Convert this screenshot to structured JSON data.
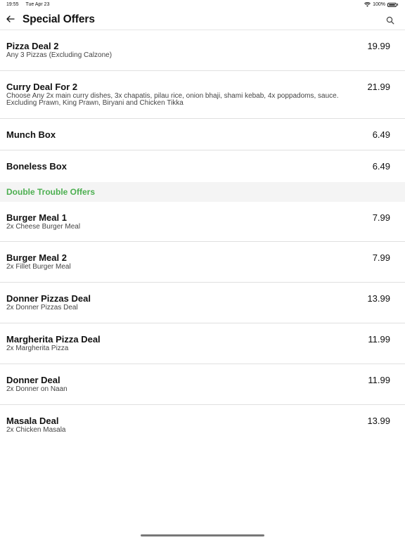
{
  "status_bar": {
    "time": "19:55",
    "date": "Tue Apr 23",
    "battery": "100%"
  },
  "header": {
    "title": "Special Offers"
  },
  "sections": [
    {
      "items": [
        {
          "name": "Pizza Deal 2",
          "description": "Any 3 Pizzas (Excluding Calzone)",
          "price": "19.99"
        },
        {
          "name": "Curry Deal For 2",
          "description": "Choose Any 2x main curry dishes, 3x chapatis, pilau rice, onion bhaji, shami kebab, 4x poppadoms, sauce. Excluding Prawn, King Prawn, Biryani and Chicken Tikka",
          "price": "21.99"
        },
        {
          "name": "Munch Box",
          "description": "",
          "price": "6.49"
        },
        {
          "name": "Boneless Box",
          "description": "",
          "price": "6.49"
        }
      ]
    },
    {
      "title": "Double Trouble Offers",
      "items": [
        {
          "name": "Burger Meal 1",
          "description": "2x Cheese Burger Meal",
          "price": "7.99"
        },
        {
          "name": "Burger Meal 2",
          "description": "2x Fillet Burger Meal",
          "price": "7.99"
        },
        {
          "name": "Donner Pizzas Deal",
          "description": "2x Donner Pizzas Deal",
          "price": "13.99"
        },
        {
          "name": "Margherita Pizza Deal",
          "description": "2x Margherita Pizza",
          "price": "11.99"
        },
        {
          "name": "Donner Deal",
          "description": "2x Donner on Naan",
          "price": "11.99"
        },
        {
          "name": "Masala Deal",
          "description": "2x Chicken Masala",
          "price": "13.99"
        }
      ]
    }
  ],
  "colors": {
    "section_title": "#4caf50",
    "divider": "#e0e0e0",
    "section_bg": "#f4f4f4"
  },
  "icons": {
    "back": "arrow-left-icon",
    "search": "search-icon",
    "wifi": "wifi-icon",
    "battery": "battery-icon"
  }
}
